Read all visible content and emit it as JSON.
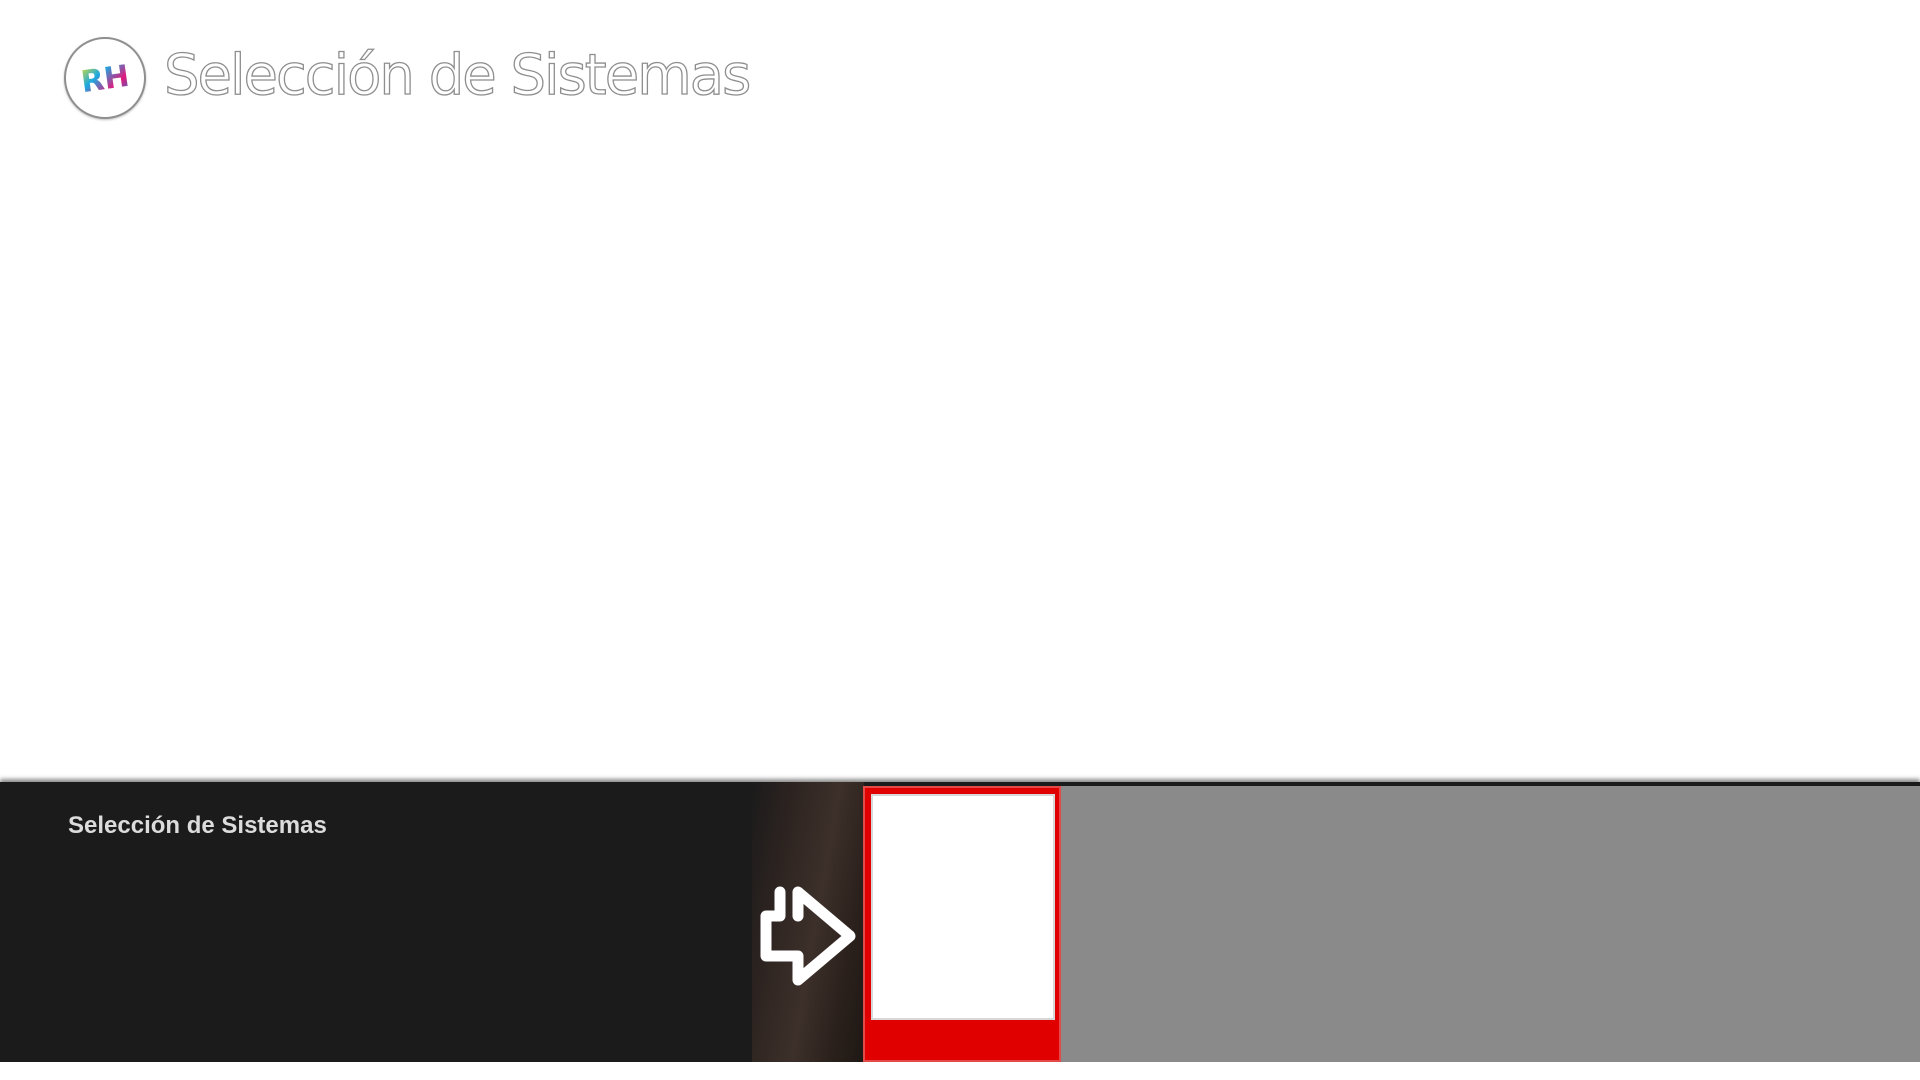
{
  "header": {
    "logo_text": "RH",
    "title": "Selección de Sistemas"
  },
  "bottom_bar": {
    "title": "Selección de Sistemas",
    "arrow_icon": "arrow-right-icon",
    "selected_tile_color": "#e00000"
  },
  "colors": {
    "background": "#ffffff",
    "bar_background": "#1b1b1b",
    "panel_gray": "#8a8a8a",
    "accent_red": "#e00000"
  }
}
